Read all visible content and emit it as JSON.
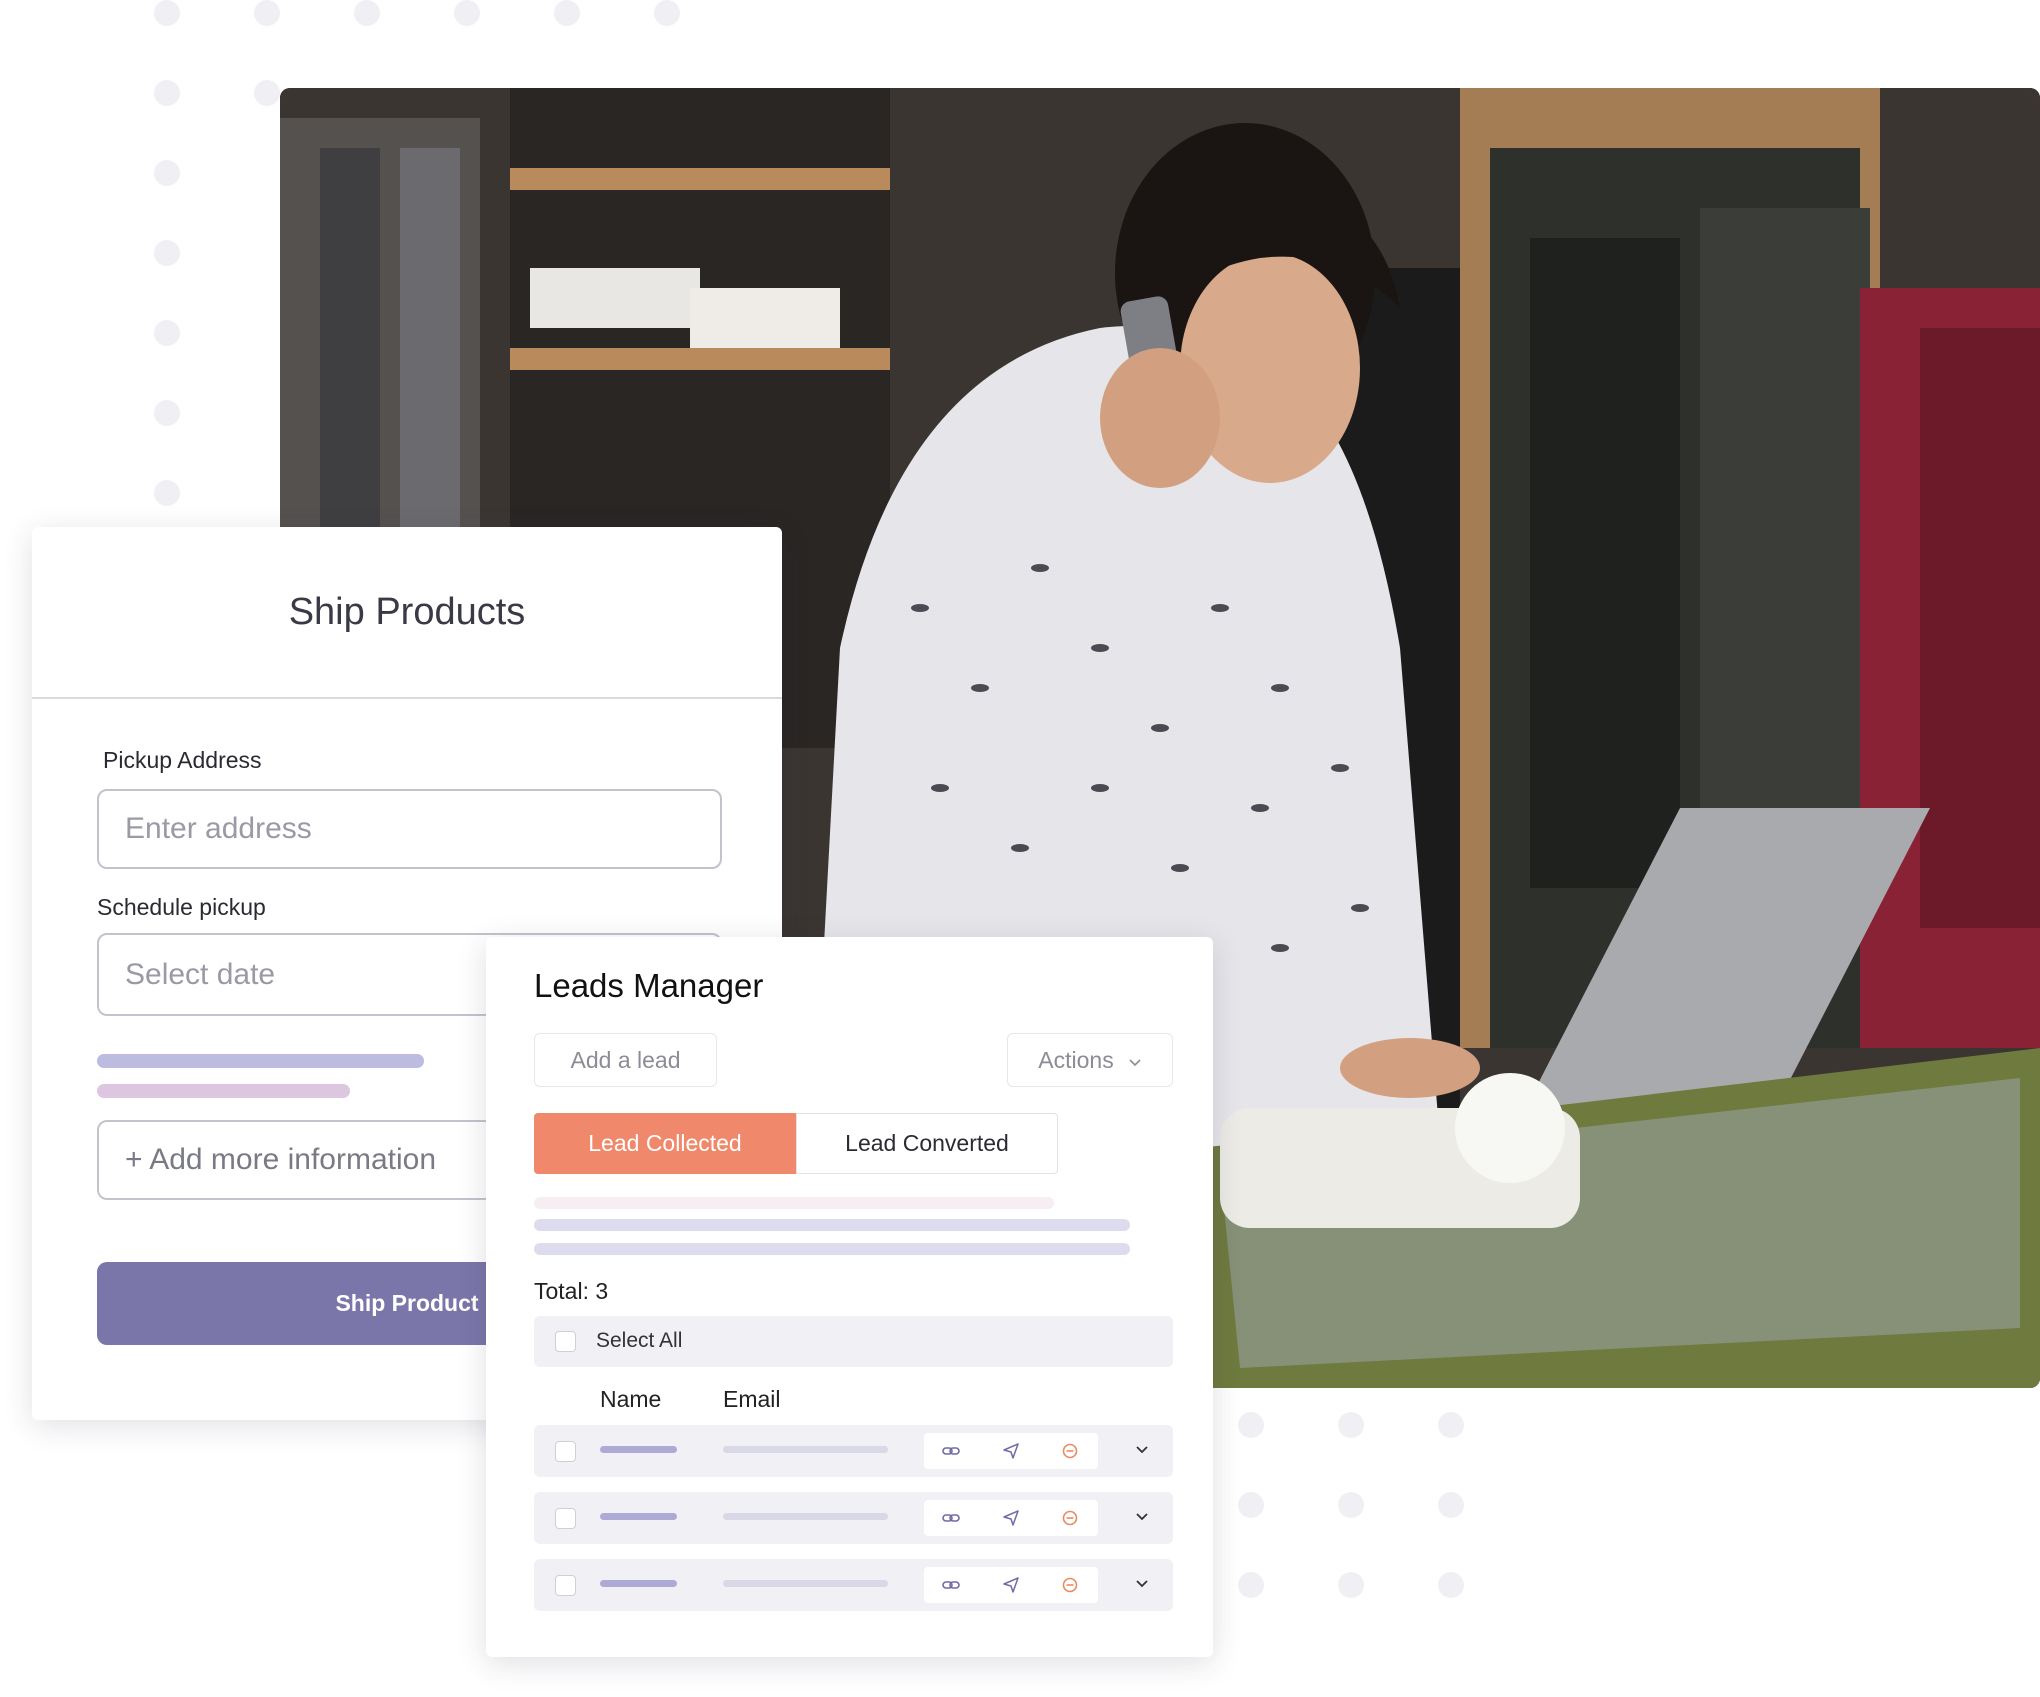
{
  "ship_products": {
    "title": "Ship Products",
    "pickup_label": "Pickup Address",
    "pickup_placeholder": "Enter address",
    "schedule_label": "Schedule pickup",
    "schedule_placeholder": "Select date",
    "add_info": "+ Add more information",
    "submit": "Ship Product"
  },
  "leads_manager": {
    "title": "Leads Manager",
    "add_lead": "Add a lead",
    "actions": "Actions",
    "tabs": [
      "Lead Collected",
      "Lead Converted"
    ],
    "active_tab": "Lead Collected",
    "total": "Total: 3",
    "select_all": "Select All",
    "columns": [
      "Name",
      "Email"
    ],
    "row_icons": [
      "link-icon",
      "send-icon",
      "remove-icon",
      "chevron-down-icon"
    ]
  },
  "colors": {
    "primary": "#7b76a9",
    "accent": "#f0896b",
    "bar_purple": "#bdbbe0",
    "bar_pink": "#dcc6e0",
    "row_bg": "#f0f0f5"
  },
  "icons": [
    "link-icon",
    "send-icon",
    "remove-icon",
    "chevron-down-icon"
  ]
}
